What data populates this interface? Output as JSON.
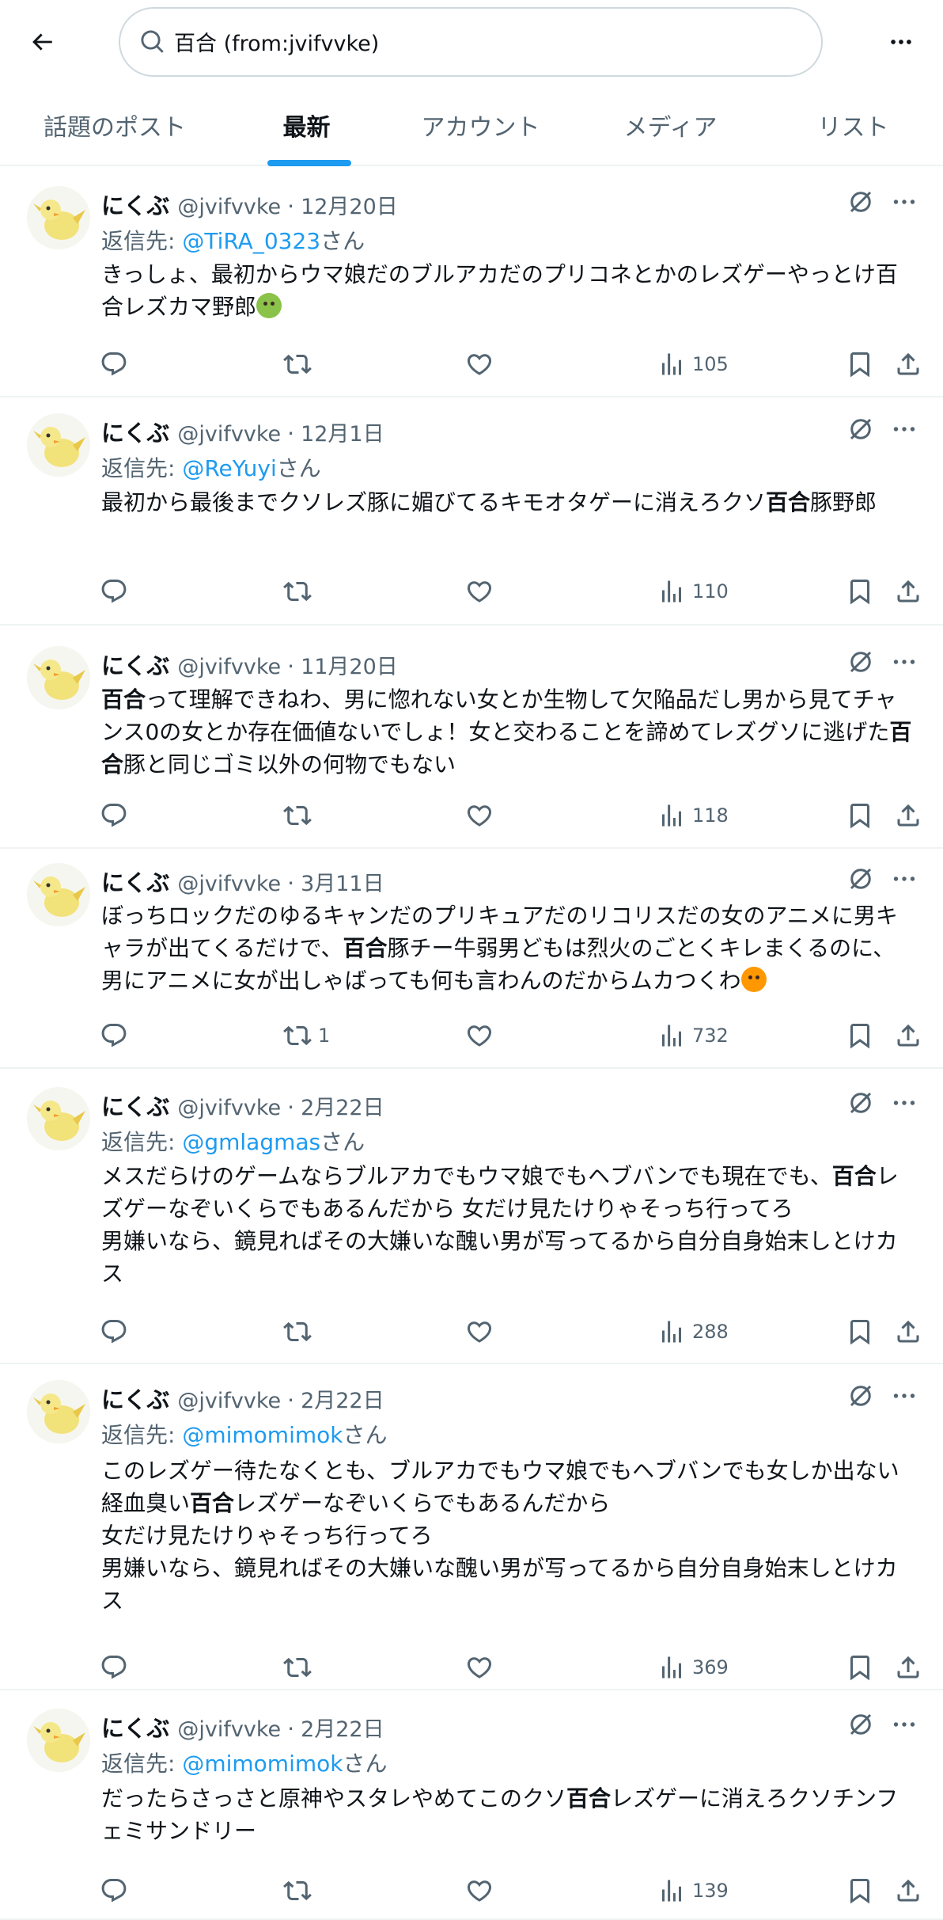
{
  "search": {
    "query": "百合 (from:jvifvvke)"
  },
  "tabs": [
    {
      "label": "話題のポスト",
      "active": false
    },
    {
      "label": "最新",
      "active": true
    },
    {
      "label": "アカウント",
      "active": false
    },
    {
      "label": "メディア",
      "active": false
    },
    {
      "label": "リスト",
      "active": false
    }
  ],
  "colors": {
    "accent": "#1d9bf0",
    "muted": "#536471",
    "text": "#0f1419",
    "border": "#eff3f4"
  },
  "tweets": [
    {
      "name": "にくぶ",
      "handle": "@jvifvvke",
      "date": "12月20日",
      "reply_prefix": "返信先: ",
      "reply_to": "@TiRA_0323",
      "reply_suffix": "さん",
      "segments": [
        [
          "きっしょ、最初からウマ娘だのブルアカだのプリコネとかのレズゲーやっとけ百合レズカマ野郎",
          false
        ]
      ],
      "emoji": "nauseated-face",
      "replies": "",
      "reposts": "",
      "likes": "",
      "views": "105"
    },
    {
      "name": "にくぶ",
      "handle": "@jvifvvke",
      "date": "12月1日",
      "reply_prefix": "返信先: ",
      "reply_to": "@ReYuyi",
      "reply_suffix": "さん",
      "segments": [
        [
          "最初から最後までクソレズ豚に媚びてるキモオタゲーに消えろクソ",
          false
        ],
        [
          "百合",
          true
        ],
        [
          "豚野郎",
          false
        ]
      ],
      "emoji": "",
      "replies": "",
      "reposts": "",
      "likes": "",
      "views": "110"
    },
    {
      "name": "にくぶ",
      "handle": "@jvifvvke",
      "date": "11月20日",
      "reply_prefix": "",
      "reply_to": "",
      "reply_suffix": "",
      "segments": [
        [
          "百合",
          true
        ],
        [
          "って理解できねわ、男に惚れない女とか生物して欠陥品だし男から見てチャンス0の女とか存在価値ないでしょ！女と交わることを諦めてレズグソに逃げた",
          false
        ],
        [
          "百合",
          true
        ],
        [
          "豚と同じゴミ以外の何物でもない",
          false
        ]
      ],
      "emoji": "",
      "replies": "",
      "reposts": "",
      "likes": "",
      "views": "118"
    },
    {
      "name": "にくぶ",
      "handle": "@jvifvvke",
      "date": "3月11日",
      "reply_prefix": "",
      "reply_to": "",
      "reply_suffix": "",
      "segments": [
        [
          "ぼっちロックだのゆるキャンだのプリキュアだのリコリスだの女のアニメに男キャラが出てくるだけで、",
          false
        ],
        [
          "百合",
          true
        ],
        [
          "豚チー牛弱男どもは烈火のごとくキレまくるのに、男にアニメに女が出しゃばっても何も言わんのだからムカつくわ",
          false
        ]
      ],
      "emoji": "pouting-face",
      "replies": "",
      "reposts": "1",
      "likes": "",
      "views": "732"
    },
    {
      "name": "にくぶ",
      "handle": "@jvifvvke",
      "date": "2月22日",
      "reply_prefix": "返信先: ",
      "reply_to": "@gmlagmas",
      "reply_suffix": "さん",
      "segments": [
        [
          "メスだらけのゲームならブルアカでもウマ娘でもヘブバンでも現在でも、",
          false
        ],
        [
          "百合",
          true
        ],
        [
          "レズゲーなぞいくらでもあるんだから 女だけ見たけりゃそっち行ってろ\n男嫌いなら、鏡見ればその大嫌いな醜い男が写ってるから自分自身始末しとけカス",
          false
        ]
      ],
      "emoji": "",
      "replies": "",
      "reposts": "",
      "likes": "",
      "views": "288"
    },
    {
      "name": "にくぶ",
      "handle": "@jvifvvke",
      "date": "2月22日",
      "reply_prefix": "返信先: ",
      "reply_to": "@mimomimok",
      "reply_suffix": "さん",
      "segments": [
        [
          "このレズゲー待たなくとも、ブルアカでもウマ娘でもヘブバンでも女しか出ない経血臭い",
          false
        ],
        [
          "百合",
          true
        ],
        [
          "レズゲーなぞいくらでもあるんだから\n女だけ見たけりゃそっち行ってろ\n男嫌いなら、鏡見ればその大嫌いな醜い男が写ってるから自分自身始末しとけカス",
          false
        ]
      ],
      "emoji": "",
      "replies": "",
      "reposts": "",
      "likes": "",
      "views": "369"
    },
    {
      "name": "にくぶ",
      "handle": "@jvifvvke",
      "date": "2月22日",
      "reply_prefix": "返信先: ",
      "reply_to": "@mimomimok",
      "reply_suffix": "さん",
      "segments": [
        [
          "だったらさっさと原神やスタレやめてこのクソ",
          false
        ],
        [
          "百合",
          true
        ],
        [
          "レズゲーに消えろクソチンフェミサンドリー",
          false
        ]
      ],
      "emoji": "",
      "replies": "",
      "reposts": "",
      "likes": "",
      "views": "139"
    }
  ]
}
